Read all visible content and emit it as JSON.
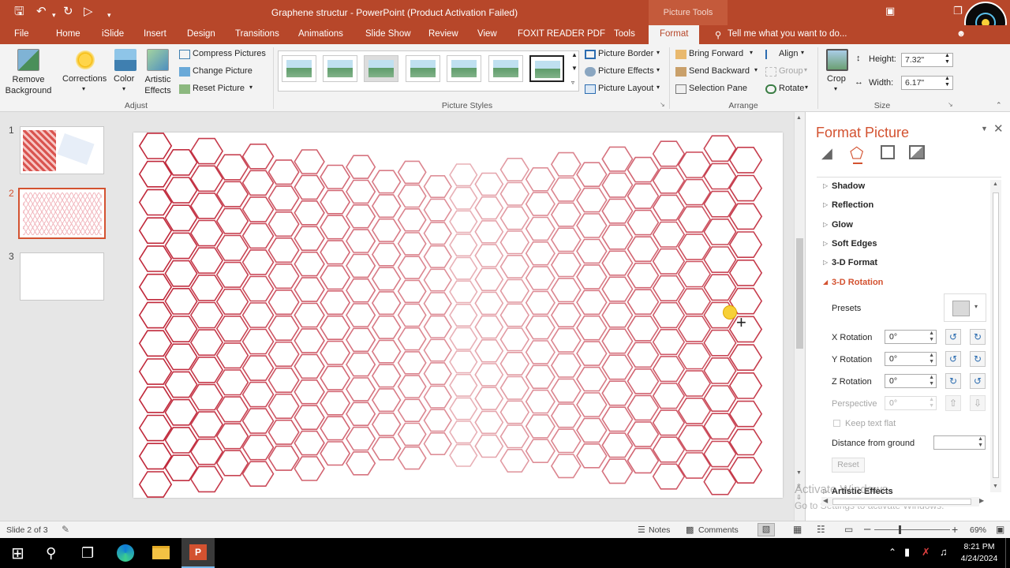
{
  "window": {
    "title": "Graphene structur - PowerPoint (Product Activation Failed)",
    "context_tab_group": "Picture Tools"
  },
  "tabs": [
    "File",
    "Home",
    "iSlide",
    "Insert",
    "Design",
    "Transitions",
    "Animations",
    "Slide Show",
    "Review",
    "View",
    "FOXIT READER PDF",
    "Tools",
    "Format"
  ],
  "active_tab": "Format",
  "tell_me": "Tell me what you want to do...",
  "ribbon": {
    "adjust": {
      "remove_background": "Remove Background",
      "corrections": "Corrections",
      "color": "Color",
      "artistic_effects": "Artistic Effects",
      "compress": "Compress Pictures",
      "change": "Change Picture",
      "reset": "Reset Picture",
      "label": "Adjust"
    },
    "picture_styles": {
      "border": "Picture Border",
      "effects": "Picture Effects",
      "layout": "Picture Layout",
      "label": "Picture Styles"
    },
    "arrange": {
      "bring_forward": "Bring Forward",
      "send_backward": "Send Backward",
      "selection_pane": "Selection Pane",
      "align": "Align",
      "group": "Group",
      "rotate": "Rotate",
      "label": "Arrange"
    },
    "size": {
      "crop": "Crop",
      "height_label": "Height:",
      "height_value": "7.32\"",
      "width_label": "Width:",
      "width_value": "6.17\"",
      "label": "Size"
    }
  },
  "slides": [
    {
      "num": "1"
    },
    {
      "num": "2"
    },
    {
      "num": "3"
    }
  ],
  "format_pane": {
    "title": "Format Picture",
    "sections": [
      "Shadow",
      "Reflection",
      "Glow",
      "Soft Edges",
      "3-D Format"
    ],
    "expanded": "3-D Rotation",
    "presets": "Presets",
    "x_rotation": {
      "label": "X Rotation",
      "value": "0°"
    },
    "y_rotation": {
      "label": "Y Rotation",
      "value": "0°"
    },
    "z_rotation": {
      "label": "Z Rotation",
      "value": "0°"
    },
    "perspective": {
      "label": "Perspective",
      "value": "0°"
    },
    "keep_text_flat": "Keep text flat",
    "distance": "Distance from ground",
    "reset": "Reset",
    "artistic": "Artistic Effects",
    "watermark1": "Activate Windows",
    "watermark2": "Go to Settings to activate Windows."
  },
  "status": {
    "slide": "Slide 2 of 3",
    "notes": "Notes",
    "comments": "Comments",
    "zoom": "69%"
  },
  "taskbar": {
    "time": "8:21 PM",
    "date": "4/24/2024"
  },
  "colors": {
    "accent": "#b7472a",
    "hex_stroke": "#c0283a"
  }
}
